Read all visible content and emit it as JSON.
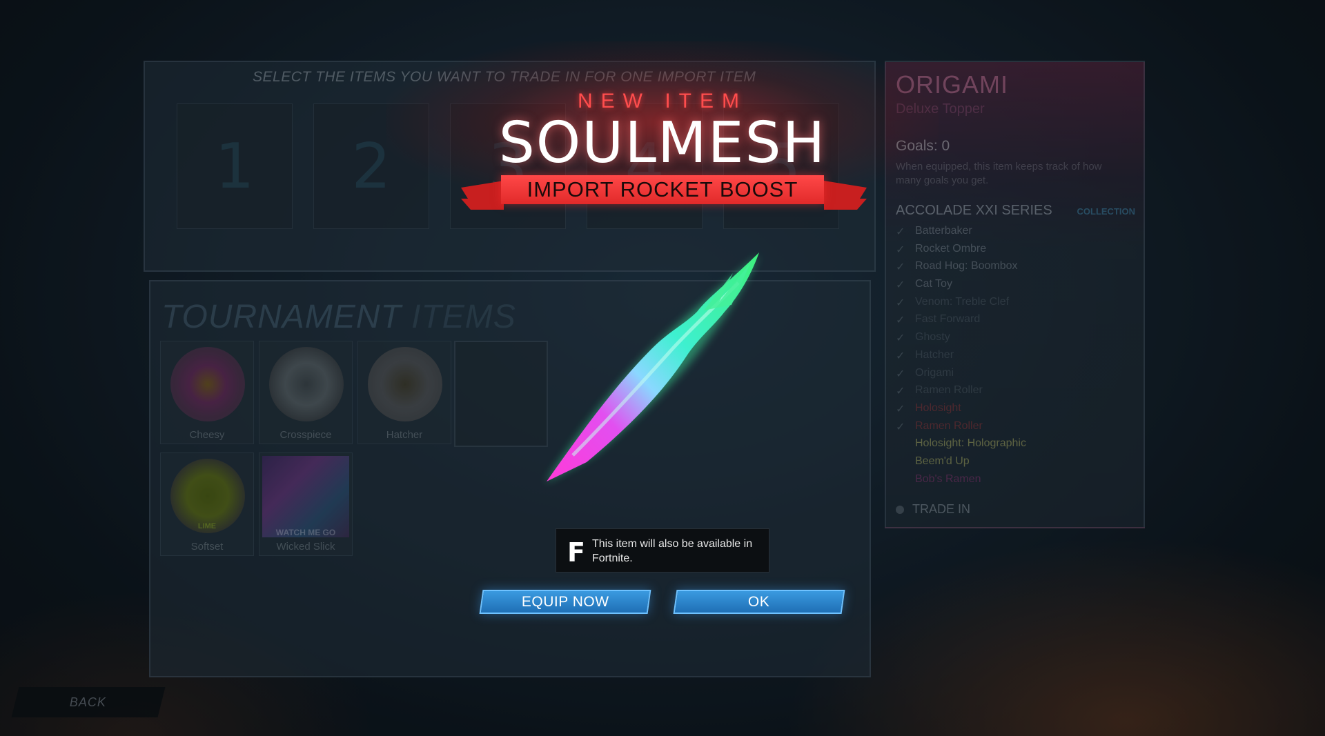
{
  "trade": {
    "header": "SELECT THE ITEMS YOU WANT TO TRADE IN FOR ONE IMPORT ITEM",
    "slots": [
      "1",
      "2",
      "3",
      "4",
      "5"
    ]
  },
  "tournament": {
    "title_main": "TOURNAMENT",
    "title_light": "ITEMS",
    "items": [
      {
        "label": "Cheesy"
      },
      {
        "label": "Crosspiece"
      },
      {
        "label": "Hatcher"
      },
      {
        "label": "Softset",
        "tag": "LIME"
      },
      {
        "label": "Wicked Slick",
        "tag": "WATCH ME GO"
      }
    ]
  },
  "info": {
    "name": "ORIGAMI",
    "type": "Deluxe Topper",
    "goals": "Goals: 0",
    "description": "When equipped, this item keeps track of how many goals you get.",
    "series_title": "ACCOLADE XXI SERIES",
    "collection_label": "COLLECTION",
    "series_items": [
      "Batterbaker",
      "Rocket Ombre",
      "Road Hog: Boombox",
      "Cat Toy",
      "Venom: Treble Clef",
      "Fast Forward",
      "Ghosty",
      "Hatcher",
      "Origami",
      "Ramen Roller",
      "Holosight",
      "Ramen Roller",
      "Holosight: Holographic",
      "Beem'd Up",
      "Bob's Ramen"
    ],
    "trade_in_label": "TRADE IN"
  },
  "back_label": "BACK",
  "reveal": {
    "heading": "NEW ITEM",
    "item_name": "SOULMESH",
    "item_type": "IMPORT ROCKET BOOST",
    "fortnite_icon": "F",
    "fortnite_note": "This item will also be available in Fortnite.",
    "equip_label": "EQUIP NOW",
    "ok_label": "OK"
  },
  "colors": {
    "accent_red": "#ff4848",
    "button_blue": "#2a84cc",
    "boost_green": "#3ef0a0",
    "boost_pink": "#ff3ad8"
  }
}
